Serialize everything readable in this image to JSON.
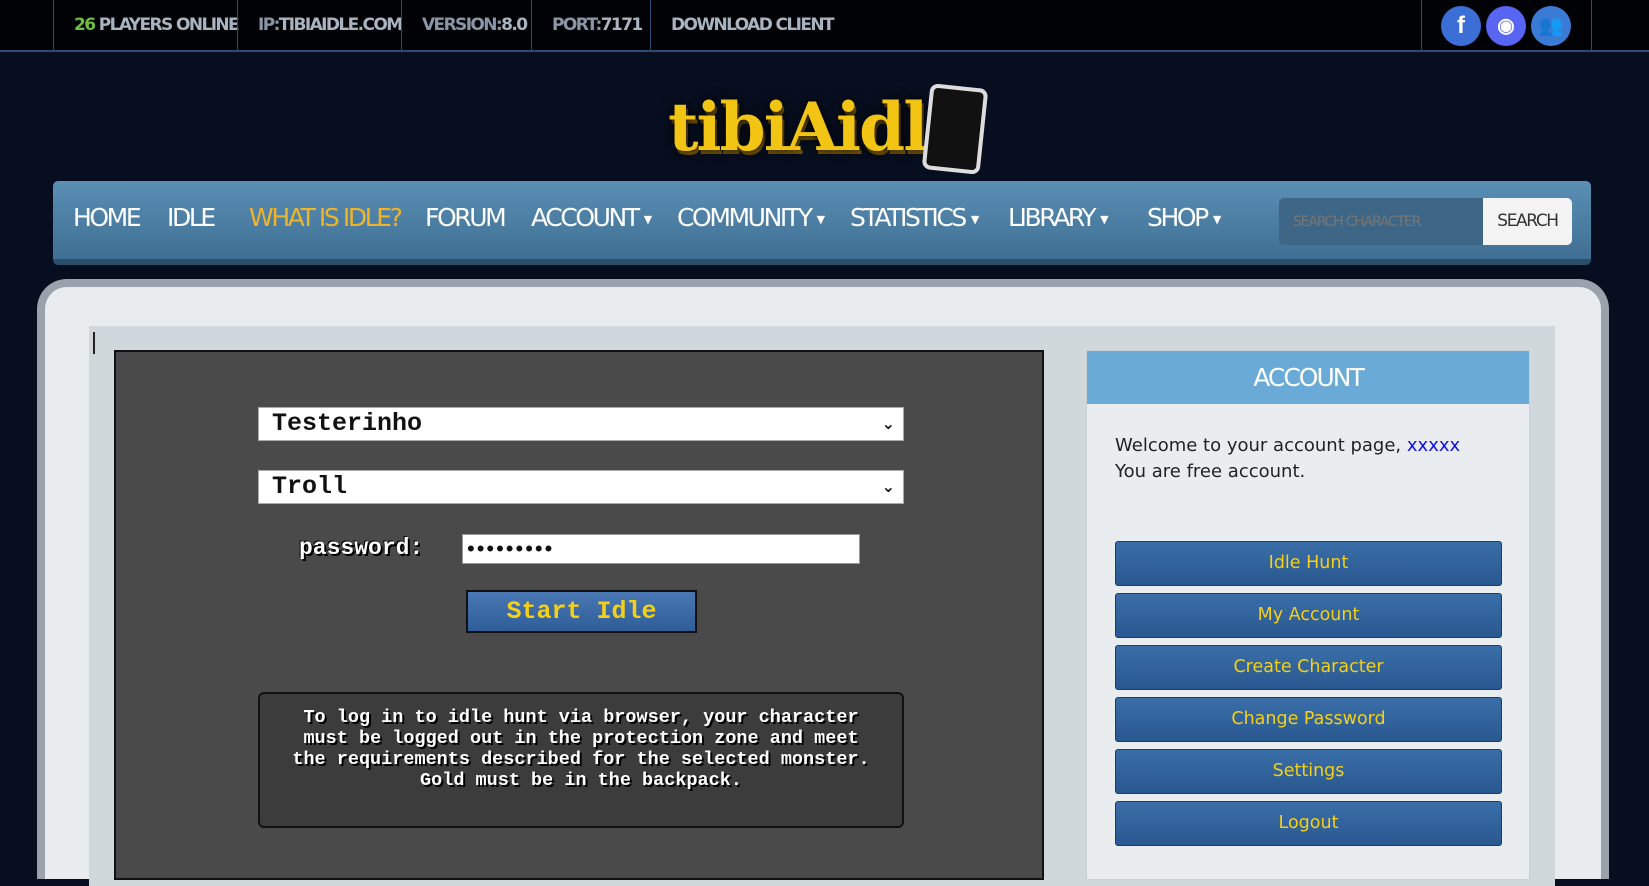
{
  "topbar": {
    "players_count": "26",
    "players_label": " PLAYERS ONLINE",
    "ip_label": "IP:",
    "ip_value": "TIBIAIDLE.COM",
    "version_label": "VERSION:",
    "version_value": "8.0",
    "port_label": "PORT:",
    "port_value": "7171",
    "download": "DOWNLOAD CLIENT",
    "social": [
      {
        "icon": "facebook-icon",
        "glyph": "f",
        "color": "#3b6fd6"
      },
      {
        "icon": "discord-icon",
        "glyph": "◉",
        "color": "#5865f2"
      },
      {
        "icon": "community-icon",
        "glyph": "👥",
        "color": "#3a7bd5"
      }
    ]
  },
  "logo": {
    "text": "tibiAidle"
  },
  "nav": {
    "items": [
      {
        "label": "HOME"
      },
      {
        "label": "IDLE"
      },
      {
        "label": "WHAT IS IDLE?",
        "active": true
      },
      {
        "label": "FORUM"
      },
      {
        "label": "ACCOUNT",
        "dropdown": true
      },
      {
        "label": "COMMUNITY",
        "dropdown": true
      },
      {
        "label": "STATISTICS",
        "dropdown": true
      },
      {
        "label": "LIBRARY",
        "dropdown": true
      },
      {
        "label": "SHOP",
        "dropdown": true
      }
    ],
    "search_placeholder": "SEARCH CHARACTER",
    "search_button": "SEARCH"
  },
  "idle_form": {
    "character": "Testerinho",
    "monster": "Troll",
    "password_label": "password:",
    "password_value": "•••••••••",
    "start_button": "Start Idle",
    "info": "To log in to idle hunt via browser, your character must be logged out in the protection zone and meet the requirements described for the selected monster. Gold must be in the backpack."
  },
  "account": {
    "title": "ACCOUNT",
    "welcome": "Welcome to your account page, ",
    "username": "xxxxx",
    "status": "You are free account.",
    "buttons": [
      "Idle Hunt",
      "My Account",
      "Create Character",
      "Change Password",
      "Settings",
      "Logout"
    ]
  },
  "colors": {
    "accent_yellow": "#f5d016",
    "nav_blue": "#4f82a8",
    "players_green": "#6fbf3f"
  }
}
